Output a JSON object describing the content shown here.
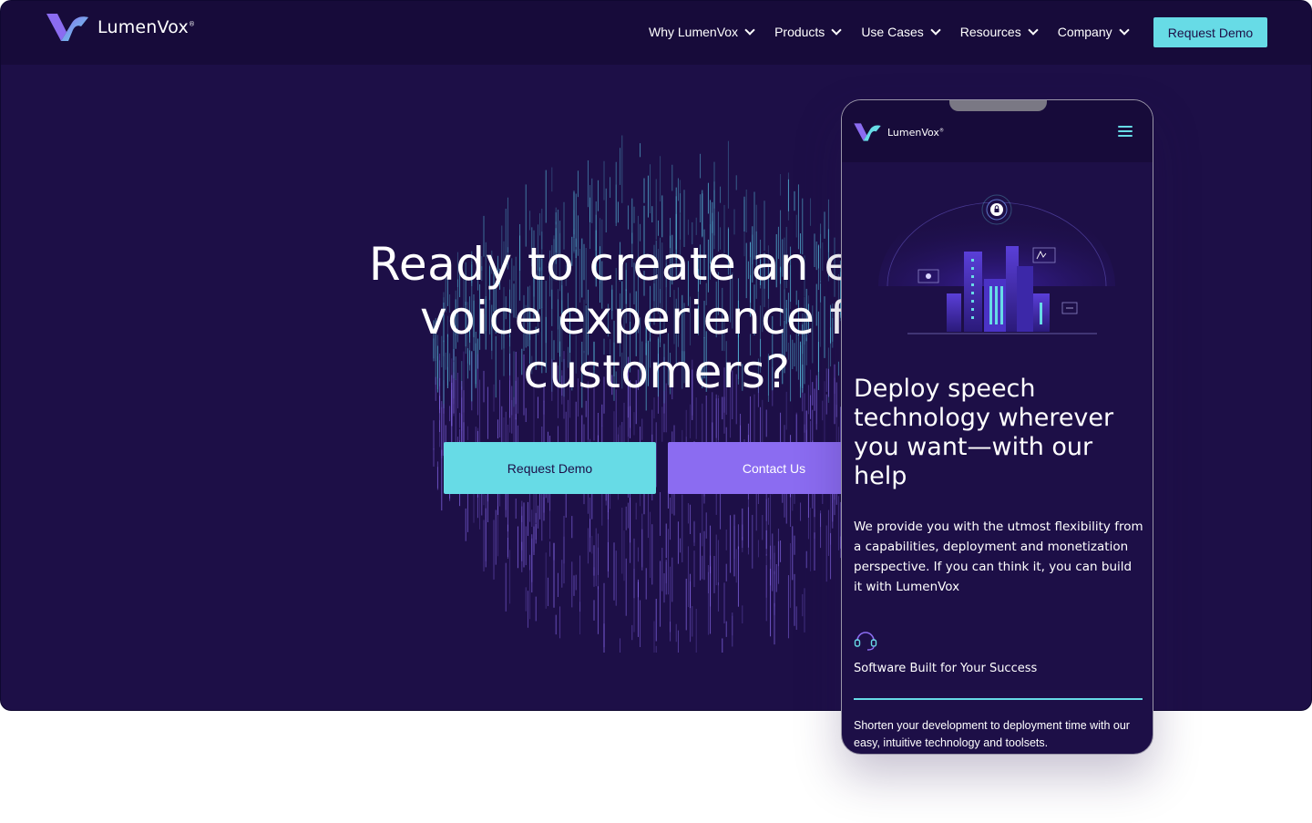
{
  "brand": {
    "name": "LumenVox",
    "registered": "®"
  },
  "nav": {
    "items": [
      {
        "label": "Why LumenVox"
      },
      {
        "label": "Products"
      },
      {
        "label": "Use Cases"
      },
      {
        "label": "Resources"
      },
      {
        "label": "Company"
      }
    ],
    "cta_label": "Request Demo"
  },
  "hero": {
    "title_line1": "Ready to create an extra",
    "title_line2": "voice experience for",
    "title_line3": "customers?",
    "primary_button": "Request Demo",
    "secondary_button": "Contact Us"
  },
  "mobile": {
    "title": "Deploy speech technology wherever you want—with our help",
    "body": "We provide you with the utmost flexibility from a capabilities, deployment and monetization perspective. If you can think it, you can build it with LumenVox",
    "feature_title": "Software Built for Your Success",
    "feature_desc": "Shorten your development to deployment time with our easy, intuitive technology and toolsets."
  },
  "colors": {
    "background": "#1d0f47",
    "nav_background": "#170b3a",
    "accent_cyan": "#67dbe6",
    "accent_purple": "#8b6cf1"
  },
  "icons": [
    "logo-icon",
    "chevron-down-icon",
    "hamburger-icon",
    "lock-icon",
    "headset-icon"
  ]
}
